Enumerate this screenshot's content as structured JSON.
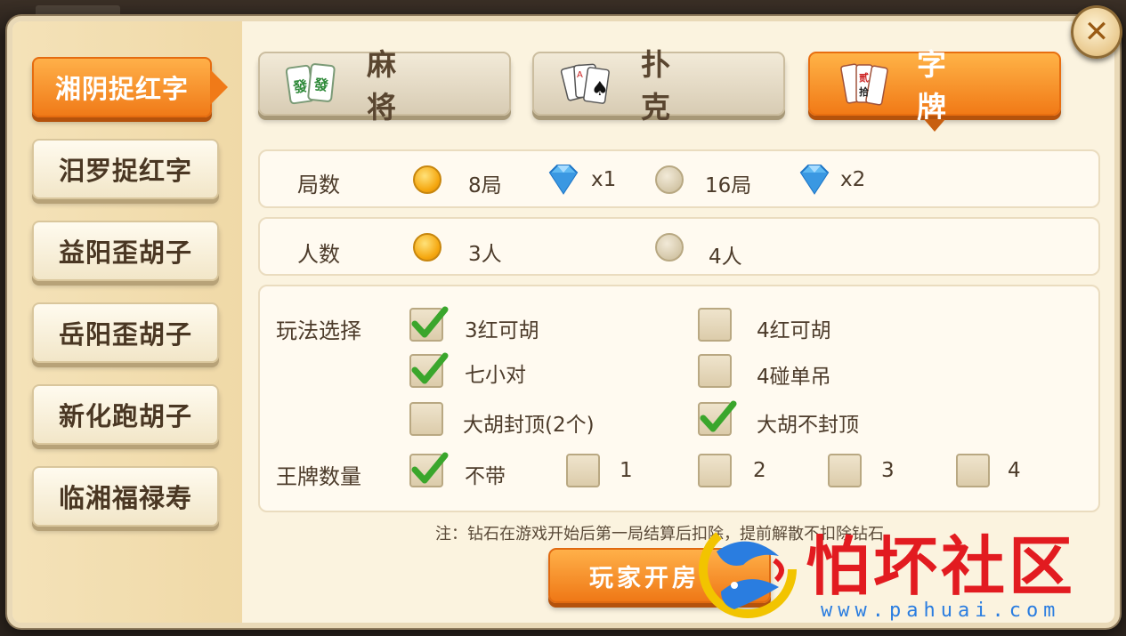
{
  "sidebar": {
    "items": [
      {
        "label": "湘阴捉红字",
        "active": true
      },
      {
        "label": "汨罗捉红字",
        "active": false
      },
      {
        "label": "益阳歪胡子",
        "active": false
      },
      {
        "label": "岳阳歪胡子",
        "active": false
      },
      {
        "label": "新化跑胡子",
        "active": false
      },
      {
        "label": "临湘福禄寿",
        "active": false
      }
    ]
  },
  "tabs": [
    {
      "label": "麻将",
      "icon": "mahjong-tile-icon",
      "active": false
    },
    {
      "label": "扑克",
      "icon": "playing-cards-icon",
      "active": false
    },
    {
      "label": "字牌",
      "icon": "word-cards-icon",
      "active": true
    }
  ],
  "rounds": {
    "label": "局数",
    "options": [
      {
        "text": "8局",
        "cost": "x1",
        "selected": true
      },
      {
        "text": "16局",
        "cost": "x2",
        "selected": false
      }
    ]
  },
  "players": {
    "label": "人数",
    "options": [
      {
        "text": "3人",
        "selected": true
      },
      {
        "text": "4人",
        "selected": false
      }
    ]
  },
  "rules": {
    "label": "玩法选择",
    "options": [
      {
        "text": "3红可胡",
        "checked": true
      },
      {
        "text": "4红可胡",
        "checked": false
      },
      {
        "text": "七小对",
        "checked": true
      },
      {
        "text": "4碰单吊",
        "checked": false
      },
      {
        "text": "大胡封顶(2个)",
        "checked": false
      },
      {
        "text": "大胡不封顶",
        "checked": true
      }
    ]
  },
  "king_cards": {
    "label": "王牌数量",
    "options": [
      {
        "text": "不带",
        "checked": true
      },
      {
        "text": "1",
        "checked": false
      },
      {
        "text": "2",
        "checked": false
      },
      {
        "text": "3",
        "checked": false
      },
      {
        "text": "4",
        "checked": false
      }
    ]
  },
  "note": "注：钻石在游戏开始后第一局结算后扣除，提前解散不扣除钻石。",
  "create_button": "玩家开房",
  "watermark": {
    "text": "怕坏社区",
    "url": "www.pahuai.com"
  },
  "colors": {
    "accent": "#f07a18",
    "panel": "#fbf3df",
    "text": "#4c3b2a"
  }
}
